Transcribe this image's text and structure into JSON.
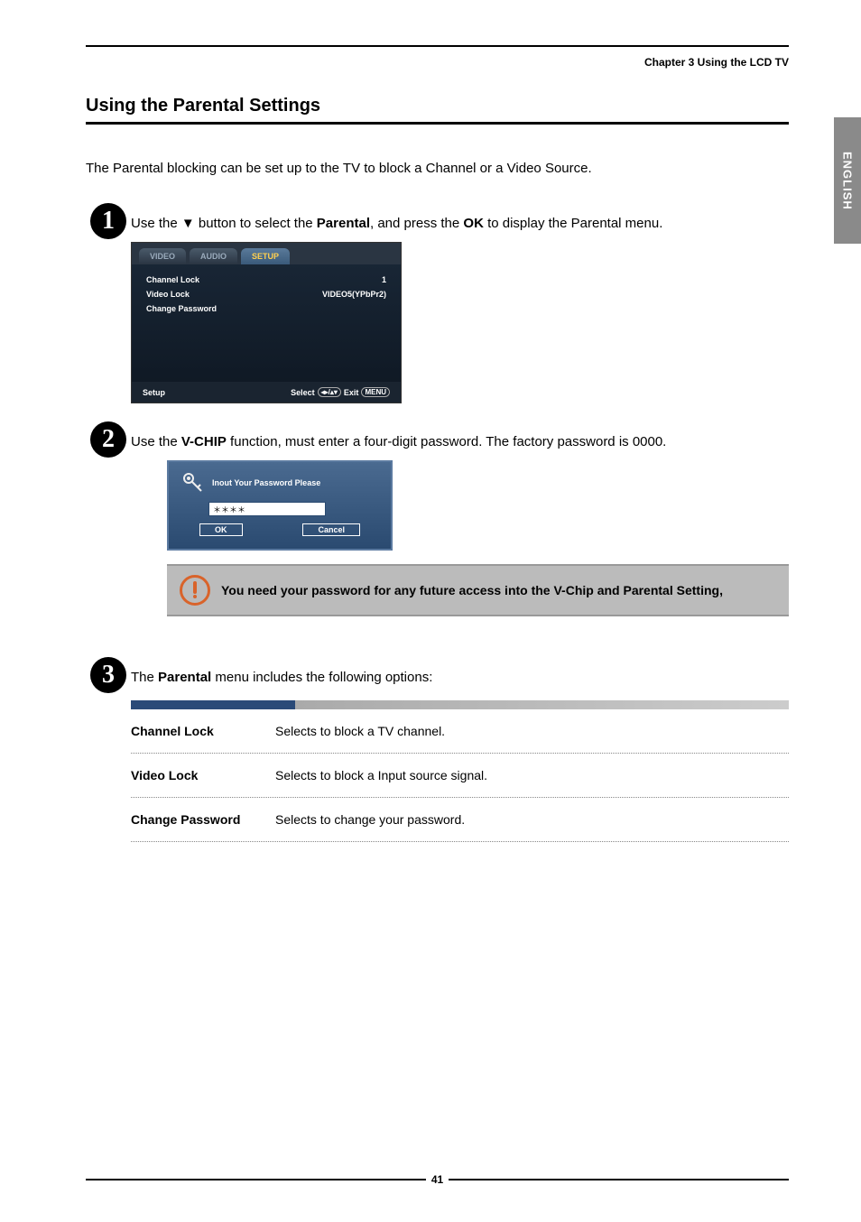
{
  "chapter": "Chapter 3 Using the LCD TV",
  "side_tab": "ENGLISH",
  "section_title": "Using  the Parental Settings",
  "intro": "The Parental blocking can be set up to the TV to block a Channel or a Video Source.",
  "steps": {
    "one": {
      "num": "1",
      "text_before": "Use the ▼ button to select the ",
      "bold1": "Parental",
      "text_mid": ",  and press the ",
      "bold2": "OK",
      "text_after": " to display the Parental menu."
    },
    "two": {
      "num": "2",
      "text_before": "Use the ",
      "bold1": "V-CHIP",
      "text_after": " function, must enter a four-digit password. The factory password is 0000."
    },
    "three": {
      "num": "3",
      "text_before": "The ",
      "bold1": "Parental",
      "text_after": " menu includes the following options:"
    }
  },
  "osd": {
    "tabs": {
      "video": "VIDEO",
      "audio": "AUDIO",
      "setup": "SETUP"
    },
    "rows": [
      {
        "label": "Channel Lock",
        "value": "1"
      },
      {
        "label": "Video Lock",
        "value": "VIDEO5(YPbPr2)"
      },
      {
        "label": "Change Password",
        "value": ""
      }
    ],
    "footer_left": "Setup",
    "footer_select": "Select",
    "footer_select_keys": "◂▸/▴▾",
    "footer_exit": "Exit",
    "footer_exit_key": "MENU"
  },
  "password_dialog": {
    "title": "Inout Your Password Please",
    "value": "＊＊＊＊",
    "ok": "OK",
    "cancel": "Cancel"
  },
  "note": "You need your password for any  future access into the V-Chip and Parental Setting,",
  "options": [
    {
      "name": "Channel Lock",
      "desc": "Selects to block a TV channel."
    },
    {
      "name": "Video Lock",
      "desc": "Selects to block a Input source signal."
    },
    {
      "name": "Change Password",
      "desc": "Selects to change your password."
    }
  ],
  "page_number": "41"
}
